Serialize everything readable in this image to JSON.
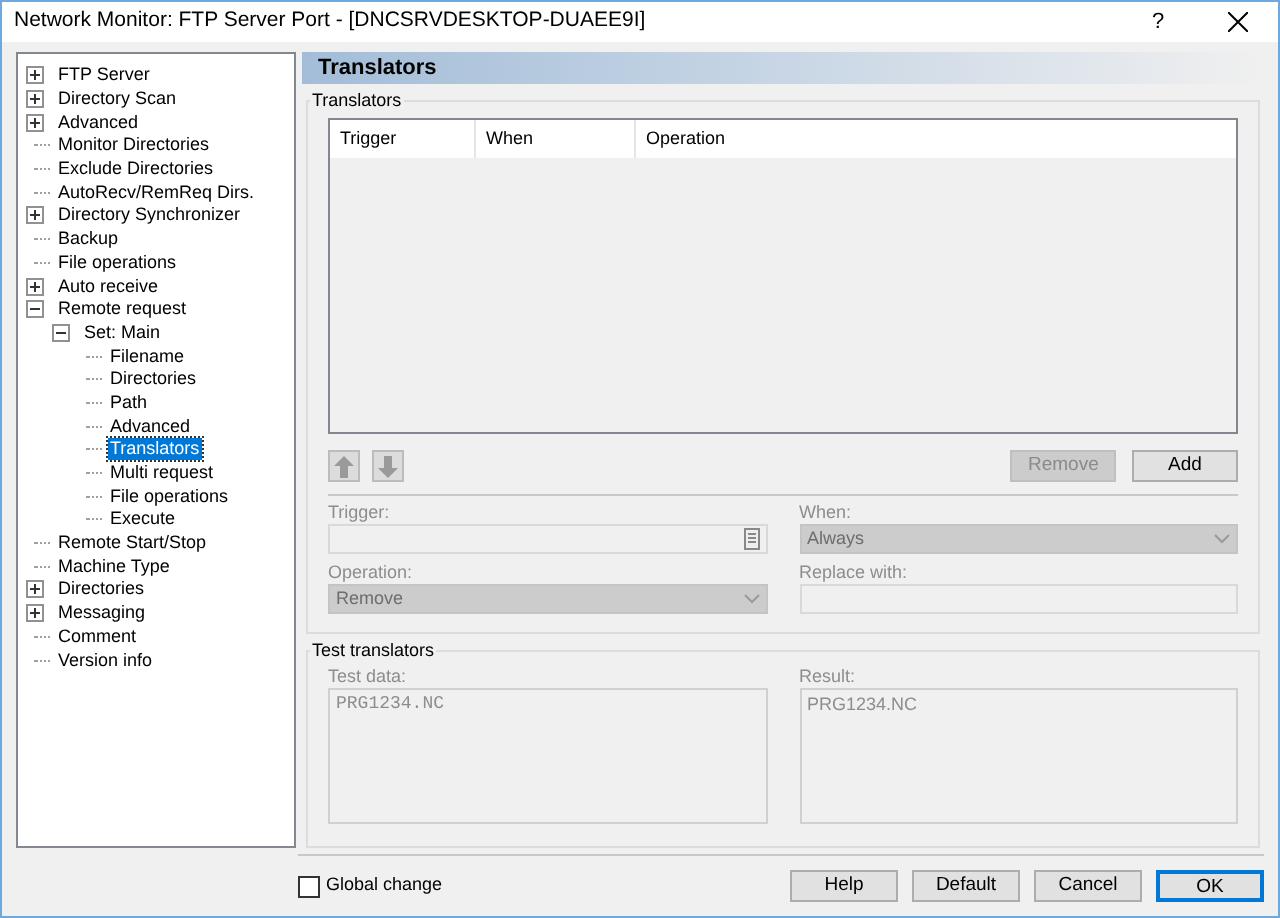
{
  "window": {
    "title": "Network Monitor: FTP Server Port - [DNCSRVDESKTOP-DUAEE9I]",
    "help": "?"
  },
  "tree": [
    {
      "label": "FTP Server",
      "expanded": false,
      "selected": false
    },
    {
      "label": "Directory Scan",
      "expanded": false,
      "selected": false
    },
    {
      "label": "Advanced",
      "expanded": false,
      "selected": false
    },
    {
      "label": "Monitor Directories",
      "selected": false
    },
    {
      "label": "Exclude Directories",
      "selected": false
    },
    {
      "label": "AutoRecv/RemReq Dirs.",
      "selected": false
    },
    {
      "label": "Directory Synchronizer",
      "expanded": false,
      "selected": false
    },
    {
      "label": "Backup",
      "selected": false
    },
    {
      "label": "File operations",
      "selected": false
    },
    {
      "label": "Auto receive",
      "expanded": false,
      "selected": false
    },
    {
      "label": "Remote request",
      "expanded": true,
      "selected": false,
      "children": [
        {
          "label": "Set: Main",
          "expanded": true,
          "selected": false,
          "children": [
            {
              "label": "Filename",
              "selected": false
            },
            {
              "label": "Directories",
              "selected": false
            },
            {
              "label": "Path",
              "selected": false
            },
            {
              "label": "Advanced",
              "selected": false
            },
            {
              "label": "Translators",
              "selected": true
            },
            {
              "label": "Multi request",
              "selected": false
            },
            {
              "label": "File operations",
              "selected": false
            },
            {
              "label": "Execute",
              "selected": false
            }
          ]
        }
      ]
    },
    {
      "label": "Remote Start/Stop",
      "selected": false
    },
    {
      "label": "Machine Type",
      "selected": false
    },
    {
      "label": "Directories",
      "expanded": false,
      "selected": false
    },
    {
      "label": "Messaging",
      "expanded": false,
      "selected": false
    },
    {
      "label": "Comment",
      "selected": false
    },
    {
      "label": "Version info",
      "selected": false
    }
  ],
  "page": {
    "title": "Translators",
    "translators": {
      "title": "Translators",
      "columns": [
        "Trigger",
        "When",
        "Operation"
      ],
      "buttons": [
        {
          "label": "Remove",
          "disabled": true
        },
        {
          "label": "Add",
          "disabled": false
        }
      ]
    },
    "form": {
      "trigger": {
        "label": "Trigger:"
      },
      "when": {
        "label": "When:",
        "value": "Always"
      },
      "operation": {
        "label": "Operation:",
        "value": "Remove"
      },
      "replace": {
        "label": "Replace with:"
      }
    },
    "test": {
      "title": "Test translators",
      "data_label": "Test data:",
      "data_value": "PRG1234.NC",
      "result_label": "Result:",
      "result_value": "PRG1234.NC"
    }
  },
  "footer": {
    "global_change": {
      "label": "Global change",
      "checked": false
    },
    "buttons": [
      {
        "label": "Help",
        "default": false
      },
      {
        "label": "Default",
        "default": false
      },
      {
        "label": "Cancel",
        "default": false
      },
      {
        "label": "OK",
        "default": true
      }
    ]
  }
}
